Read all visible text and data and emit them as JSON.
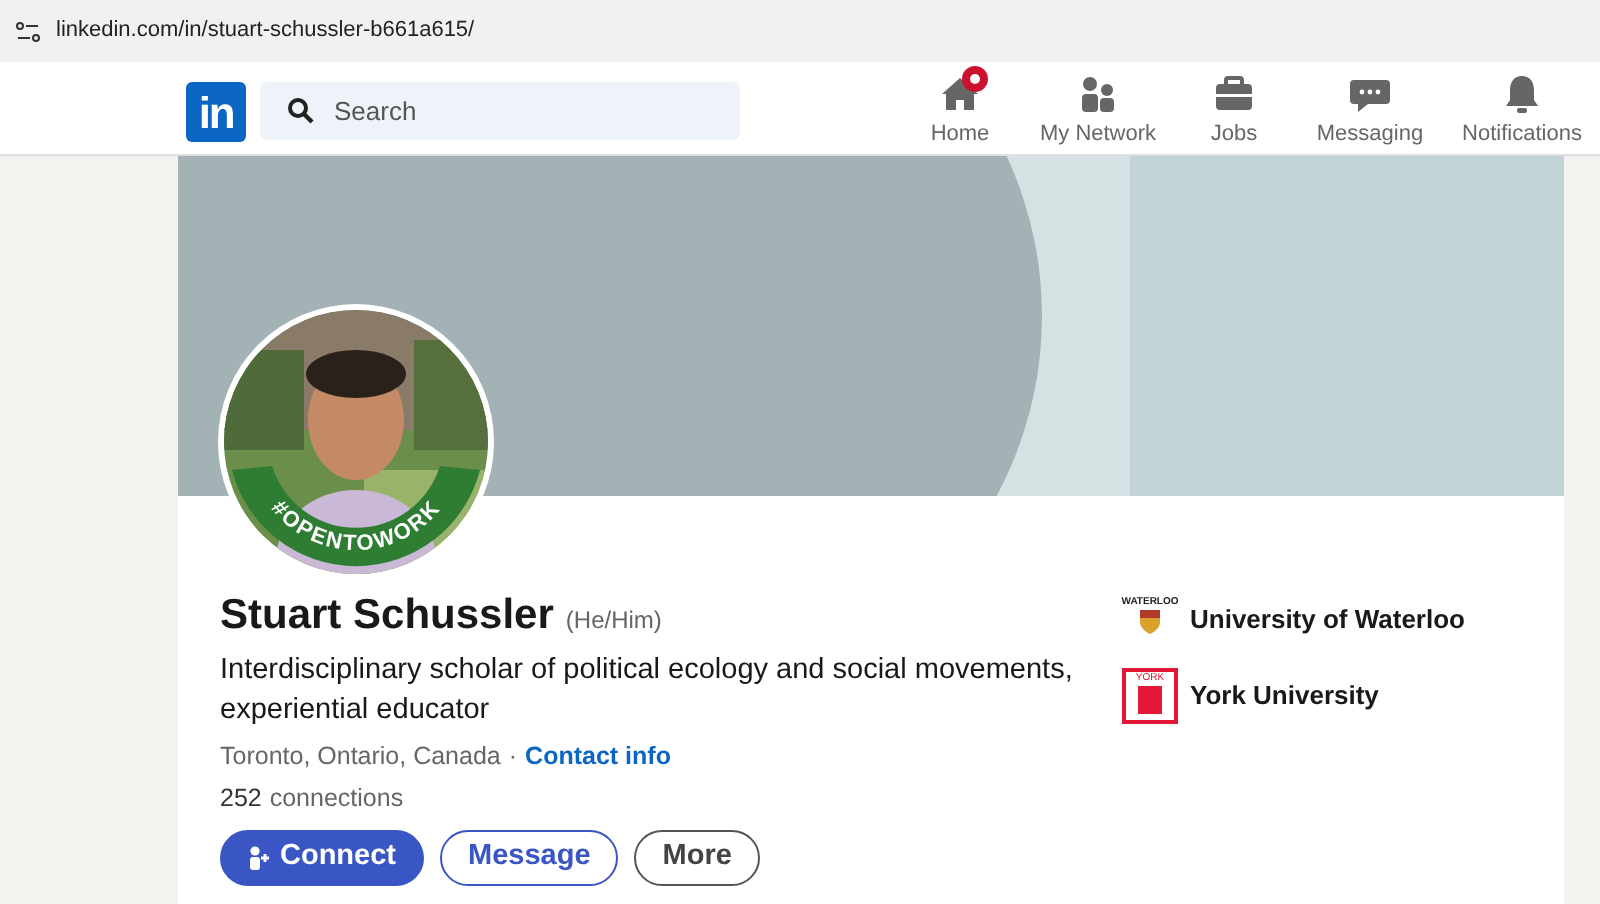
{
  "browser": {
    "url": "linkedin.com/in/stuart-schussler-b661a615/"
  },
  "nav": {
    "logo": "in",
    "search": {
      "placeholder": "Search"
    },
    "items": [
      {
        "label": "Home",
        "kind": "home",
        "badge": true
      },
      {
        "label": "My Network",
        "kind": "network",
        "badge": false
      },
      {
        "label": "Jobs",
        "kind": "jobs",
        "badge": false
      },
      {
        "label": "Messaging",
        "kind": "messaging",
        "badge": false
      },
      {
        "label": "Notifications",
        "kind": "bell",
        "badge": false
      }
    ]
  },
  "profile": {
    "frame_text": "#OPENTOWORK",
    "name": "Stuart Schussler",
    "pronouns": "(He/Him)",
    "headline": "Interdisciplinary scholar of political ecology and social movements, experiential educator",
    "location": "Toronto, Ontario, Canada",
    "separator": "·",
    "contact_link": "Contact info",
    "connections_count": "252",
    "connections_label": "connections",
    "buttons": [
      {
        "label": "Connect",
        "kind": "primary"
      },
      {
        "label": "Message",
        "kind": "outline"
      },
      {
        "label": "More",
        "kind": "plain"
      }
    ],
    "education": [
      {
        "name": "University of Waterloo",
        "kind": "waterloo",
        "logo_text": "WATERLOO"
      },
      {
        "name": "York University",
        "kind": "york",
        "logo_text": "YORK"
      }
    ]
  }
}
